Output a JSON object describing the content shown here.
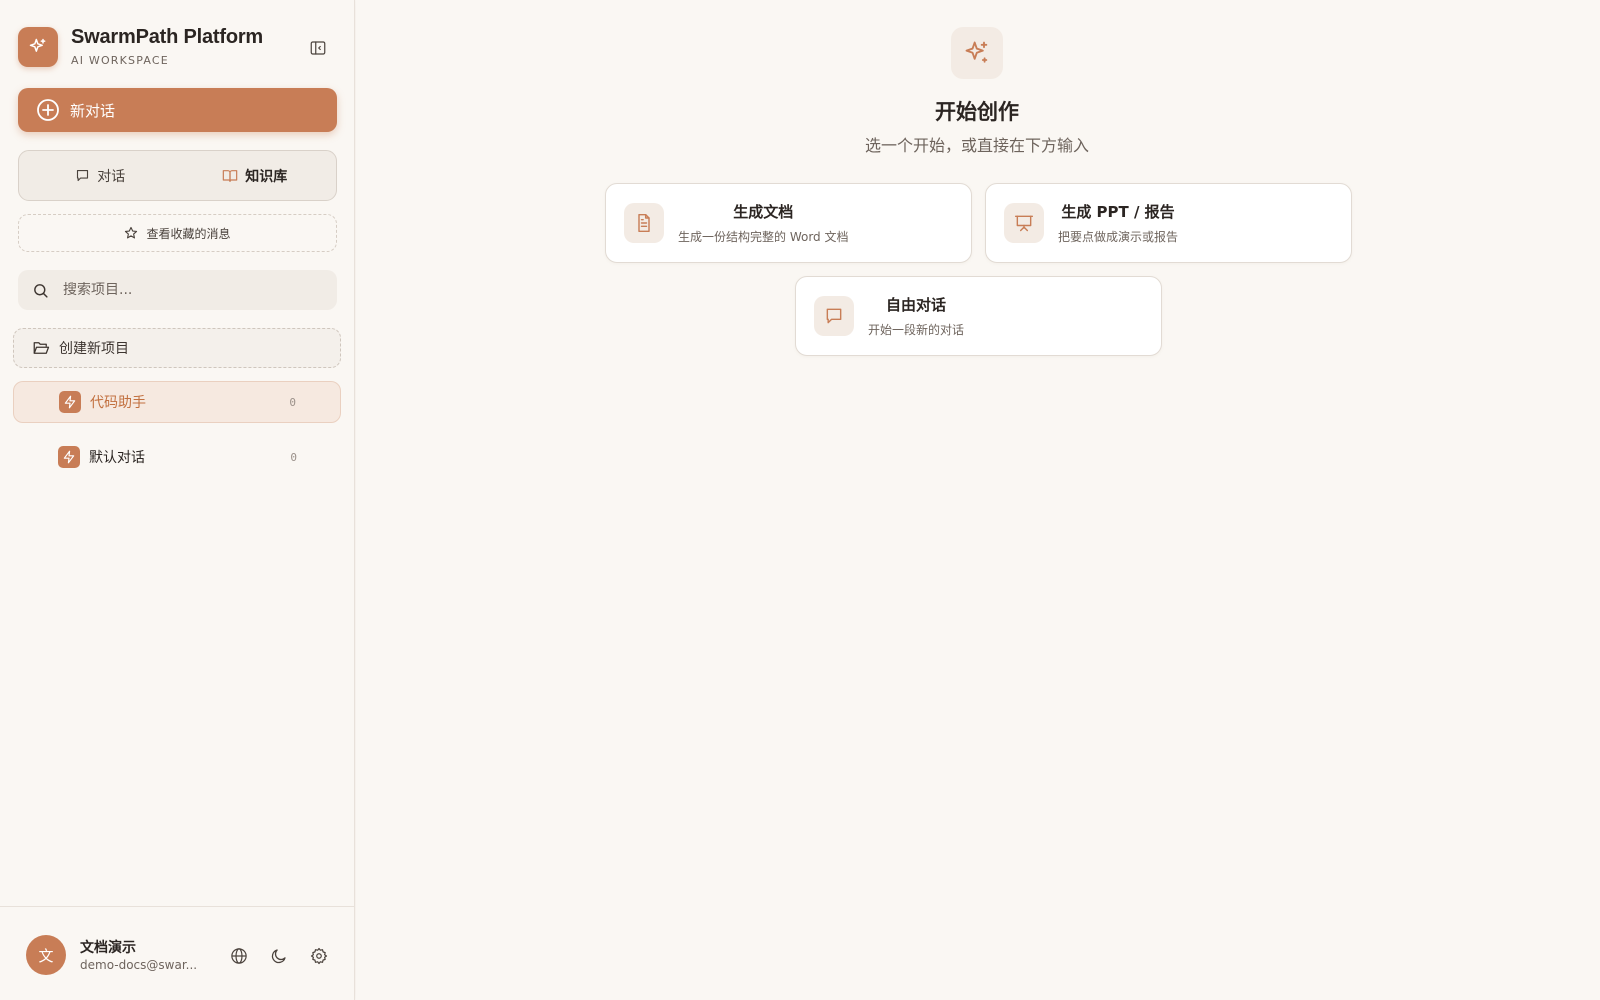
{
  "app": {
    "title": "SwarmPath Platform",
    "subtitle": "AI WORKSPACE"
  },
  "sidebar": {
    "new_chat_label": "新对话",
    "tabs": [
      {
        "label": "对话",
        "icon": "message-square-icon"
      },
      {
        "label": "知识库",
        "icon": "book-open-icon",
        "active": true
      }
    ],
    "favorites_label": "查看收藏的消息",
    "search": {
      "placeholder": "搜索项目...",
      "value": ""
    },
    "create_project_label": "创建新项目",
    "projects": [
      {
        "name": "代码助手",
        "count": "0",
        "active": true,
        "icon": "lightning-icon"
      },
      {
        "name": "默认对话",
        "count": "0",
        "active": false,
        "icon": "lightning-icon"
      }
    ]
  },
  "user": {
    "avatar_char": "文",
    "name": "文档演示",
    "email": "demo-docs@swar..."
  },
  "main": {
    "hero_icon": "sparkles-icon",
    "title": "开始创作",
    "subtitle": "选一个开始，或直接在下方输入",
    "cards": [
      {
        "title": "生成文档",
        "desc": "生成一份结构完整的 Word 文档",
        "icon": "file-text-icon"
      },
      {
        "title": "生成 PPT / 报告",
        "desc": "把要点做成演示或报告",
        "icon": "presentation-icon"
      },
      {
        "title": "自由对话",
        "desc": "开始一段新的对话",
        "icon": "message-square-icon"
      }
    ]
  },
  "colors": {
    "accent": "#c87d56",
    "background": "#faf7f3",
    "active_item_bg": "#f6e9e0",
    "card_border": "#e2dbd4"
  }
}
